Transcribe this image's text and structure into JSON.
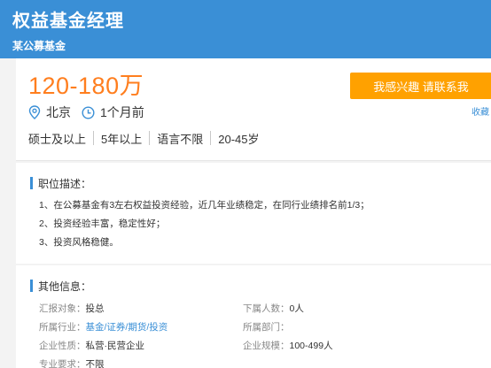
{
  "header": {
    "title": "权益基金经理",
    "company": "某公募基金"
  },
  "job": {
    "salary": "120-180万",
    "location": "北京",
    "posted": "1个月前",
    "requirements": [
      "硕士及以上",
      "5年以上",
      "语言不限",
      "20-45岁"
    ],
    "apply_label": "我感兴趣 请联系我",
    "favorite_label": "收藏"
  },
  "description": {
    "title": "职位描述：",
    "lines": [
      "1、在公募基金有3左右权益投资经验，近几年业绩稳定，在同行业绩排名前1/3；",
      "2、投资经验丰富，稳定性好；",
      "3、投资风格稳健。"
    ]
  },
  "other_info": {
    "title": "其他信息：",
    "rows": [
      [
        {
          "label": "汇报对象：",
          "value": "投总"
        },
        {
          "label": "下属人数：",
          "value": "0人"
        }
      ],
      [
        {
          "label": "所属行业：",
          "value": "基金/证券/期货/投资"
        },
        {
          "label": "所属部门：",
          "value": ""
        }
      ],
      [
        {
          "label": "企业性质：",
          "value": "私营·民营企业"
        },
        {
          "label": "企业规模：",
          "value": "100-499人"
        }
      ],
      [
        {
          "label": "专业要求：",
          "value": "不限"
        }
      ]
    ]
  },
  "colors": {
    "header_bg": "#3a8fd6",
    "salary": "#ff7e1e",
    "button": "#ffa100",
    "accent": "#3a8fd6"
  },
  "icons": {
    "location": "location-pin-icon",
    "time": "clock-icon"
  }
}
